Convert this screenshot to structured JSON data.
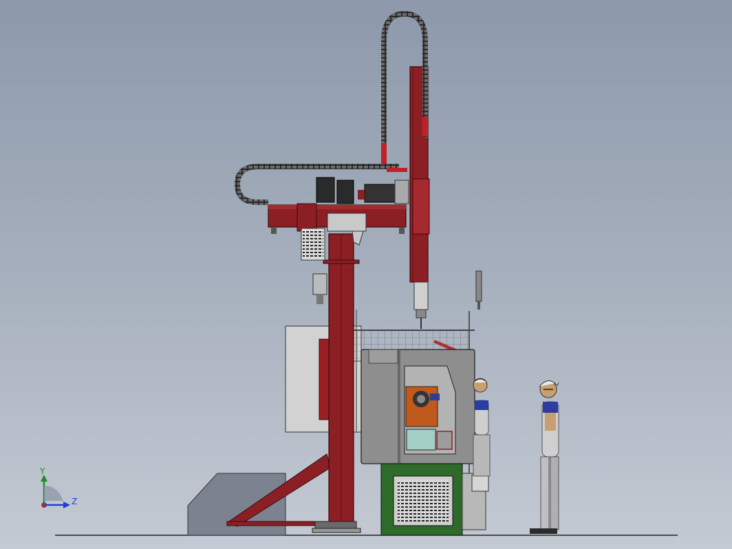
{
  "triad": {
    "y_label": "Y",
    "z_label": "Z"
  },
  "colors": {
    "background_top": "#8d99ab",
    "background_bottom": "#c4cad3",
    "frame_red": "#8b1f24",
    "frame_red_dark": "#5e1215",
    "machine_gray": "#9a9a9a",
    "base_green": "#2e6b2a",
    "axis_y": "#1e8a2e",
    "axis_z": "#2040d0"
  }
}
